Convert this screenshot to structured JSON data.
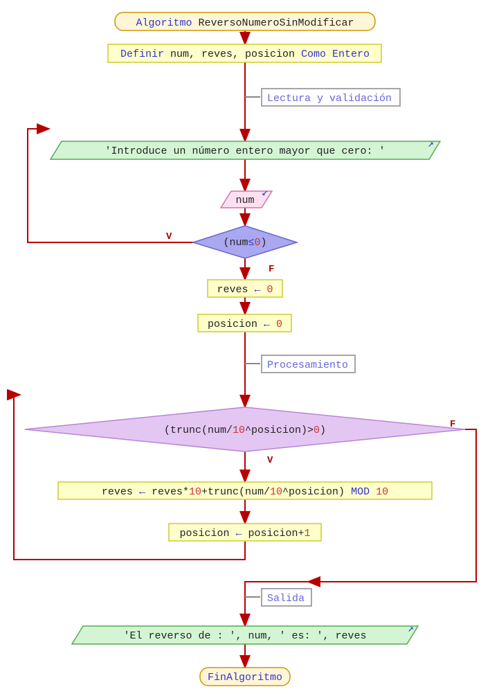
{
  "start": {
    "keyword": "Algoritmo",
    "name": "ReversoNumeroSinModificar"
  },
  "define": {
    "keyword1": "Definir",
    "vars": "num, reves, posicion",
    "keyword2": "Como Entero"
  },
  "comment1": "Lectura y validación",
  "prompt1": "'Introduce un número entero mayor que cero: '",
  "input1": "num",
  "cond1": {
    "open": "(num",
    "op": "≤",
    "val": "0",
    "close": ")"
  },
  "branch1_true": "V",
  "branch1_false": "F",
  "assign1": {
    "lhs": "reves",
    "arrow": "←",
    "rhs": "0"
  },
  "assign2": {
    "lhs": "posicion",
    "arrow": "←",
    "rhs": "0"
  },
  "comment2": "Procesamiento",
  "cond2": {
    "pre": "(trunc(num/",
    "ten": "10",
    "mid": "^posicion)>",
    "zero": "0",
    "close": ")"
  },
  "branch2_true": "V",
  "branch2_false": "F",
  "assign3": {
    "lhs": "reves",
    "arrow": "←",
    "part1": "reves*",
    "ten1": "10",
    "part2": "+trunc(num/",
    "ten2": "10",
    "part3": "^posicion)",
    "mod": " MOD ",
    "ten3": "10"
  },
  "assign4": {
    "lhs": "posicion",
    "arrow": "←",
    "part1": "posicion+",
    "one": "1"
  },
  "comment3": "Salida",
  "output": {
    "s1": "'El reverso de : '",
    "s2": ", num, ",
    "s3": "' es: '",
    "s4": ", reves"
  },
  "end": "FinAlgoritmo"
}
